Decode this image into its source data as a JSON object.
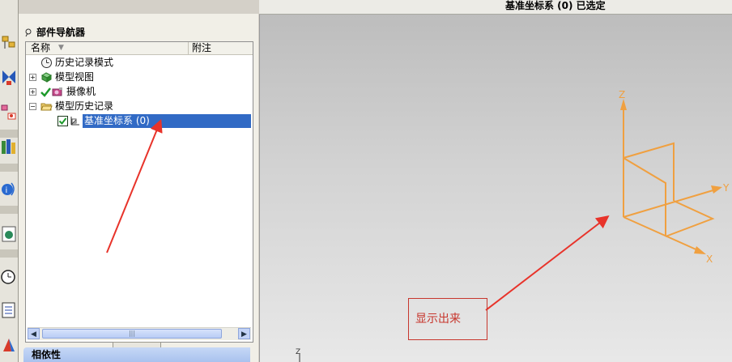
{
  "status_bar": {
    "text": "基准坐标系 (0) 已选定"
  },
  "navigator": {
    "title": "部件导航器",
    "columns": {
      "name": "名称",
      "note": "附注"
    },
    "items": [
      {
        "label": "历史记录模式"
      },
      {
        "label": "模型视图"
      },
      {
        "label": "摄像机"
      },
      {
        "label": "模型历史记录"
      },
      {
        "label": "基准坐标系 (0)"
      }
    ]
  },
  "properties_panel": {
    "title": "相依性"
  },
  "viewport": {
    "axis_labels": {
      "z": "Z",
      "y": "Y",
      "x": "X",
      "mini_z": "Z"
    },
    "csys_color": "#f0a040"
  },
  "annotation": {
    "text": "显示出来",
    "color": "#c7362d"
  }
}
